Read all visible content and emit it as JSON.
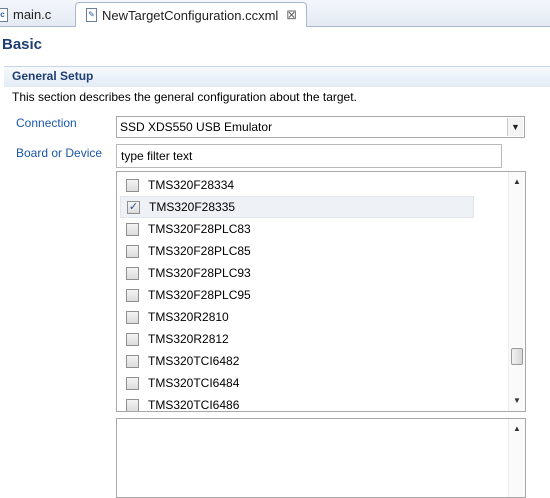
{
  "tabs": [
    {
      "label": "main.c",
      "icon": "c-file-icon"
    },
    {
      "label": "NewTargetConfiguration.ccxml",
      "icon": "xml-file-icon",
      "close": "⊠"
    }
  ],
  "page": {
    "title": "Basic",
    "section_title": "General Setup",
    "description": "This section describes the general configuration about the target."
  },
  "form": {
    "connection_label": "Connection",
    "connection_value": "SSD XDS550 USB Emulator",
    "board_label": "Board or Device",
    "filter_value": "type filter text"
  },
  "devices": [
    {
      "name": "TMS320F28334",
      "checked": false
    },
    {
      "name": "TMS320F28335",
      "checked": true
    },
    {
      "name": "TMS320F28PLC83",
      "checked": false
    },
    {
      "name": "TMS320F28PLC85",
      "checked": false
    },
    {
      "name": "TMS320F28PLC93",
      "checked": false
    },
    {
      "name": "TMS320F28PLC95",
      "checked": false
    },
    {
      "name": "TMS320R2810",
      "checked": false
    },
    {
      "name": "TMS320R2812",
      "checked": false
    },
    {
      "name": "TMS320TCI6482",
      "checked": false
    },
    {
      "name": "TMS320TCI6484",
      "checked": false
    },
    {
      "name": "TMS320TCI6486",
      "checked": false
    }
  ],
  "colors": {
    "heading": "#1f3e73",
    "label": "#1c57a6",
    "selected_row": "#eef1f5"
  }
}
